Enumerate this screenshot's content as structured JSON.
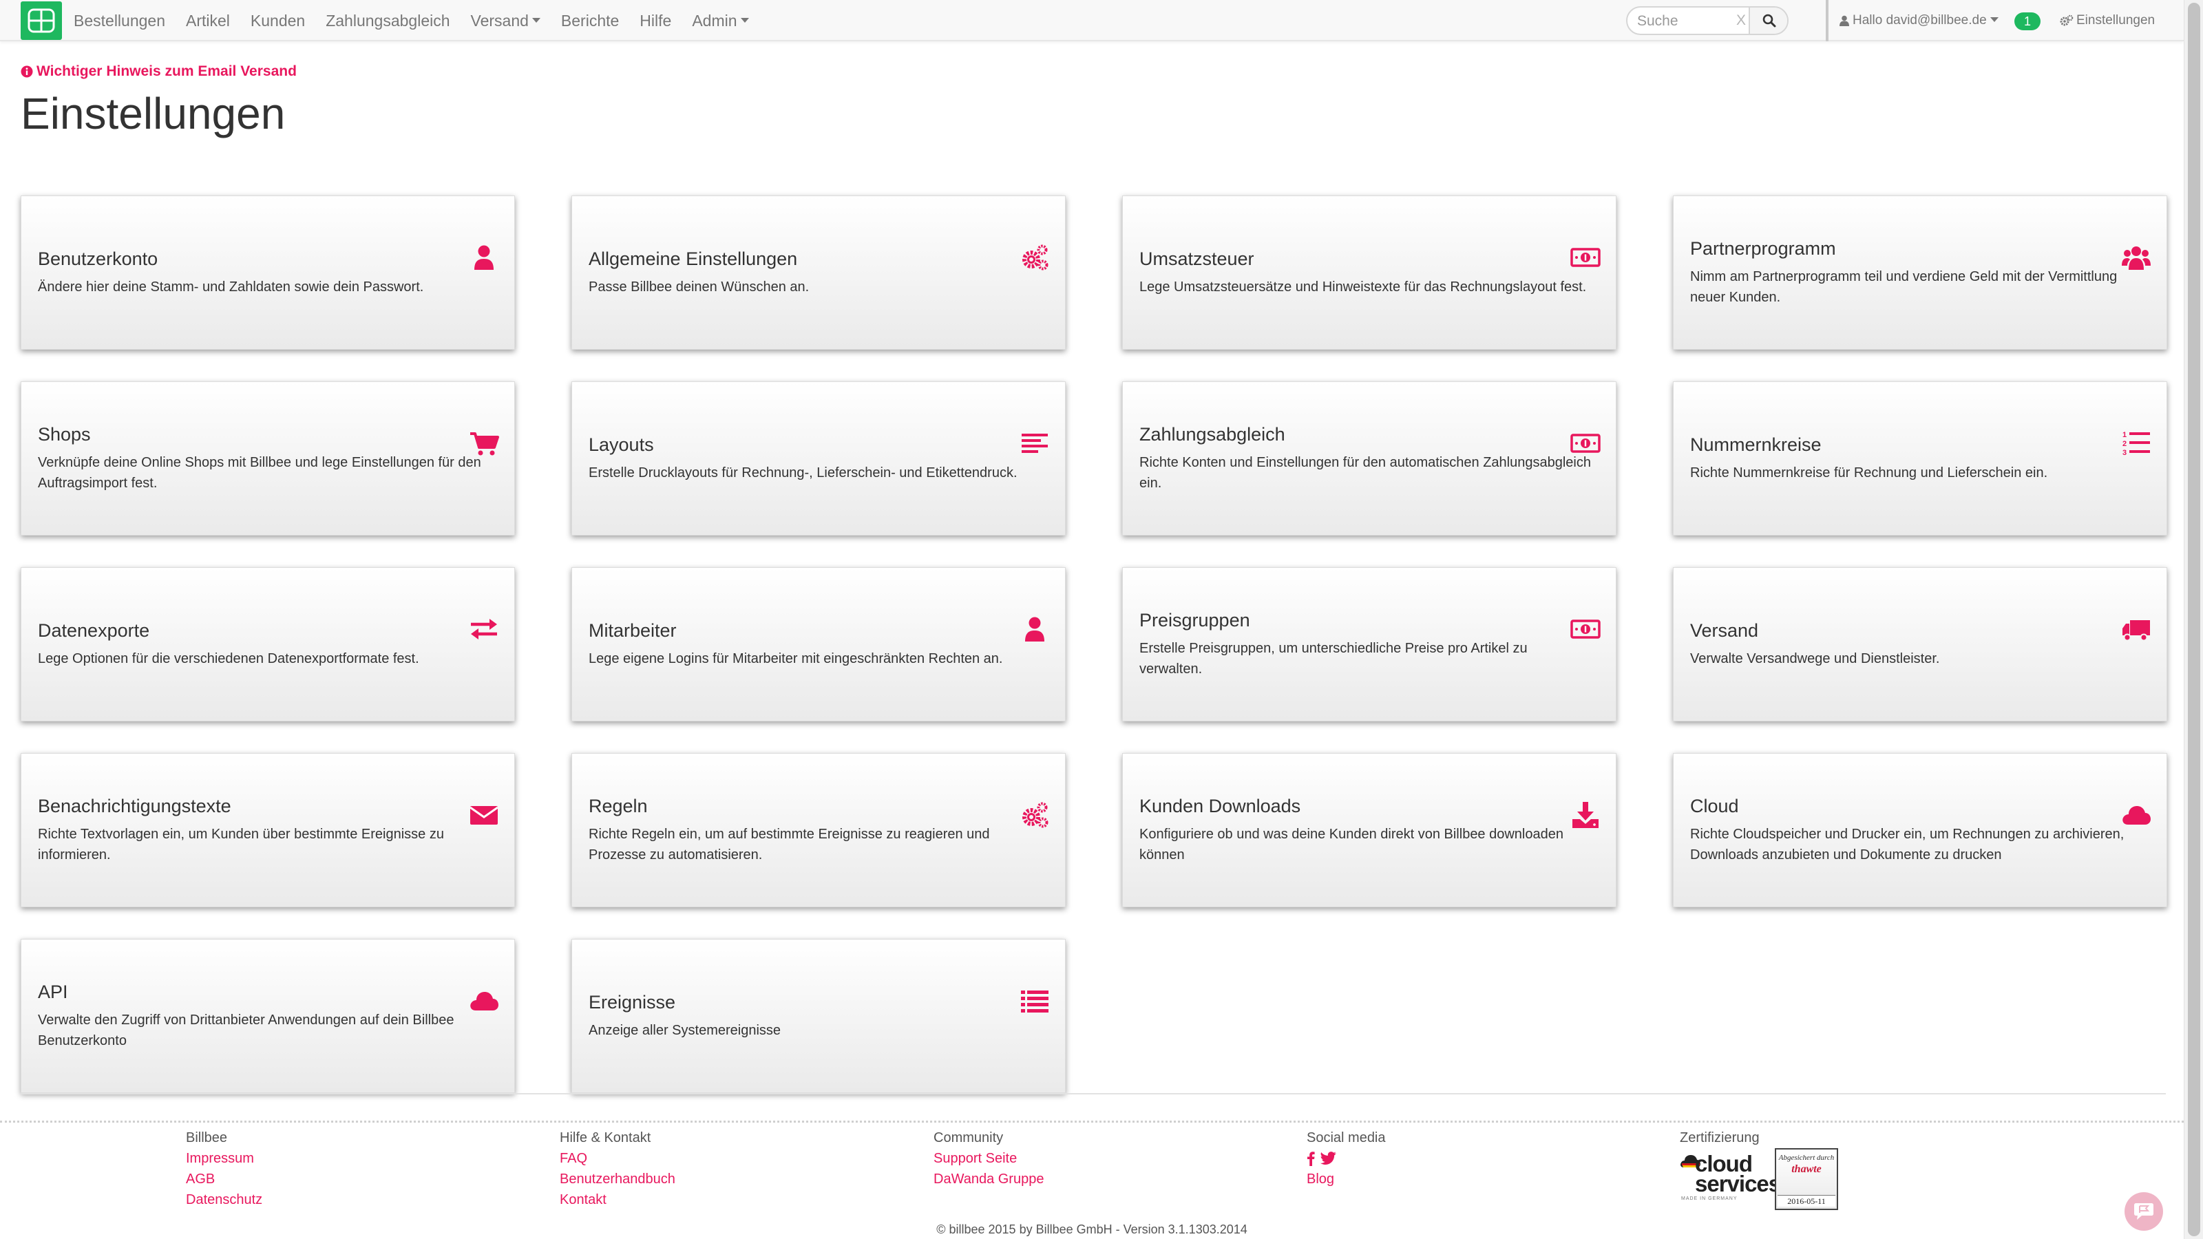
{
  "navbar": {
    "items": [
      {
        "label": "Bestellungen"
      },
      {
        "label": "Artikel"
      },
      {
        "label": "Kunden"
      },
      {
        "label": "Zahlungsabgleich"
      },
      {
        "label": "Versand"
      },
      {
        "label": "Berichte"
      },
      {
        "label": "Hilfe"
      },
      {
        "label": "Admin"
      }
    ],
    "search_placeholder": "Suche",
    "search_clear": "X",
    "user_label": "Hallo david@billbee.de",
    "notification_count": "1",
    "settings_label": "Einstellungen"
  },
  "notice": "Wichtiger Hinweis zum Email Versand",
  "page_title": "Einstellungen",
  "cards": [
    {
      "title": "Benutzerkonto",
      "description": "Ändere hier deine Stamm- und Zahldaten sowie dein Passwort.",
      "icon": "user-icon"
    },
    {
      "title": "Allgemeine Einstellungen",
      "description": "Passe Billbee deinen Wünschen an.",
      "icon": "gears-icon"
    },
    {
      "title": "Umsatzsteuer",
      "description": "Lege Umsatzsteuersätze und Hinweistexte für das Rechnungslayout fest.",
      "icon": "money-icon"
    },
    {
      "title": "Partnerprogramm",
      "description": "Nimm am Partnerprogramm teil und verdiene Geld mit der Vermittlung neuer Kunden.",
      "icon": "users-icon"
    },
    {
      "title": "Shops",
      "description": "Verknüpfe deine Online Shops mit Billbee und lege Einstellungen für den Auftragsimport fest.",
      "icon": "shopping-cart-icon"
    },
    {
      "title": "Layouts",
      "description": "Erstelle Drucklayouts für Rechnung-, Lieferschein- und Etikettendruck.",
      "icon": "align-left-icon"
    },
    {
      "title": "Zahlungsabgleich",
      "description": "Richte Konten und Einstellungen für den automatischen Zahlungsabgleich ein.",
      "icon": "money-icon"
    },
    {
      "title": "Nummernkreise",
      "description": "Richte Nummernkreise für Rechnung und Lieferschein ein.",
      "icon": "ordered-list-icon"
    },
    {
      "title": "Datenexporte",
      "description": "Lege Optionen für die verschiedenen Datenexportformate fest.",
      "icon": "exchange-icon"
    },
    {
      "title": "Mitarbeiter",
      "description": "Lege eigene Logins für Mitarbeiter mit eingeschränkten Rechten an.",
      "icon": "user-icon"
    },
    {
      "title": "Preisgruppen",
      "description": "Erstelle Preisgruppen, um unterschiedliche Preise pro Artikel zu verwalten.",
      "icon": "money-icon"
    },
    {
      "title": "Versand",
      "description": "Verwalte Versandwege und Dienstleister.",
      "icon": "truck-icon"
    },
    {
      "title": "Benachrichtigungstexte",
      "description": "Richte Textvorlagen ein, um Kunden über bestimmte Ereignisse zu informieren.",
      "icon": "envelope-icon"
    },
    {
      "title": "Regeln",
      "description": "Richte Regeln ein, um auf bestimmte Ereignisse zu reagieren und Prozesse zu automatisieren.",
      "icon": "gears-icon"
    },
    {
      "title": "Kunden Downloads",
      "description": "Konfiguriere ob und was deine Kunden direkt von Billbee downloaden können",
      "icon": "download-icon"
    },
    {
      "title": "Cloud",
      "description": "Richte Cloudspeicher und Drucker ein, um Rechnungen zu archivieren, Downloads anzubieten und Dokumente zu drucken",
      "icon": "cloud-icon"
    },
    {
      "title": "API",
      "description": "Verwalte den Zugriff von Drittanbieter Anwendungen auf dein Billbee Benutzerkonto",
      "icon": "cloud-icon"
    },
    {
      "title": "Ereignisse",
      "description": "Anzeige aller Systemereignisse",
      "icon": "list-icon"
    }
  ],
  "footer": {
    "columns": [
      {
        "heading": "Billbee",
        "links": [
          "Impressum",
          "AGB",
          "Datenschutz"
        ]
      },
      {
        "heading": "Hilfe & Kontakt",
        "links": [
          "FAQ",
          "Benutzerhandbuch",
          "Kontakt"
        ]
      },
      {
        "heading": "Community",
        "links": [
          "Support Seite",
          "DaWanda Gruppe"
        ]
      },
      {
        "heading": "Social media",
        "links": [
          "Blog"
        ]
      },
      {
        "heading": "Zertifizierung",
        "links": []
      }
    ],
    "cert_cloud_text": "cloud services",
    "cert_cloud_sub": "MADE IN GERMANY",
    "cert_seal_top": "Abgesichert durch",
    "cert_seal_brand": "thawte",
    "cert_seal_date": "2016-05-11",
    "copyright": "© billbee 2015 by Billbee GmbH - Version 3.1.1303.2014"
  },
  "colors": {
    "accent": "#e8175d",
    "brand_green": "#1eb85f"
  }
}
